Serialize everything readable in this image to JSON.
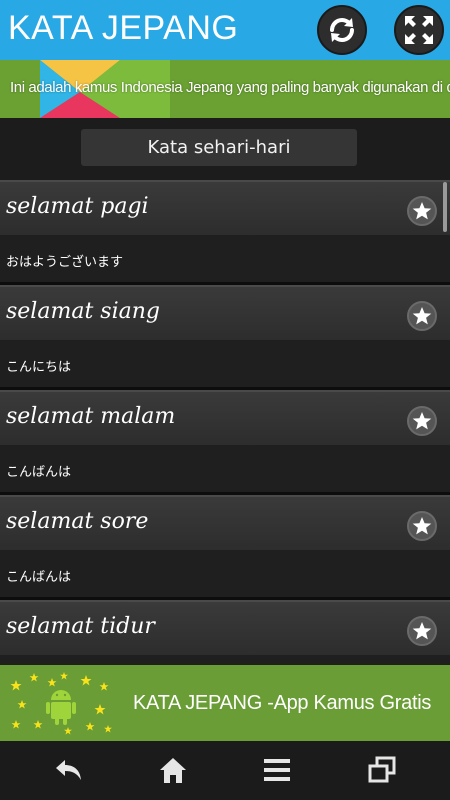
{
  "header": {
    "title": "KATA JEPANG",
    "refresh_icon": "refresh-icon",
    "expand_icon": "expand-icon",
    "color": "#29a8e6"
  },
  "banner": {
    "text": "Ini adalah kamus Indonesia Jepang yang paling banyak digunakan di dunia.",
    "color": "#6aa132"
  },
  "category": {
    "label": "Kata sehari-hari"
  },
  "list": {
    "items": [
      {
        "word": "selamat pagi",
        "japanese": "おはようございます"
      },
      {
        "word": "selamat siang",
        "japanese": "こんにちは"
      },
      {
        "word": "selamat malam",
        "japanese": "こんばんは"
      },
      {
        "word": "selamat sore",
        "japanese": "こんばんは"
      },
      {
        "word": "selamat tidur",
        "japanese": ""
      }
    ],
    "favorite_icon": "star-icon"
  },
  "ad": {
    "text": "KATA JEPANG -App Kamus Gratis",
    "icon": "android-icon",
    "color": "#6a9d36"
  },
  "navbar": {
    "icons": [
      "back-icon",
      "home-icon",
      "menu-icon",
      "recent-apps-icon"
    ]
  }
}
